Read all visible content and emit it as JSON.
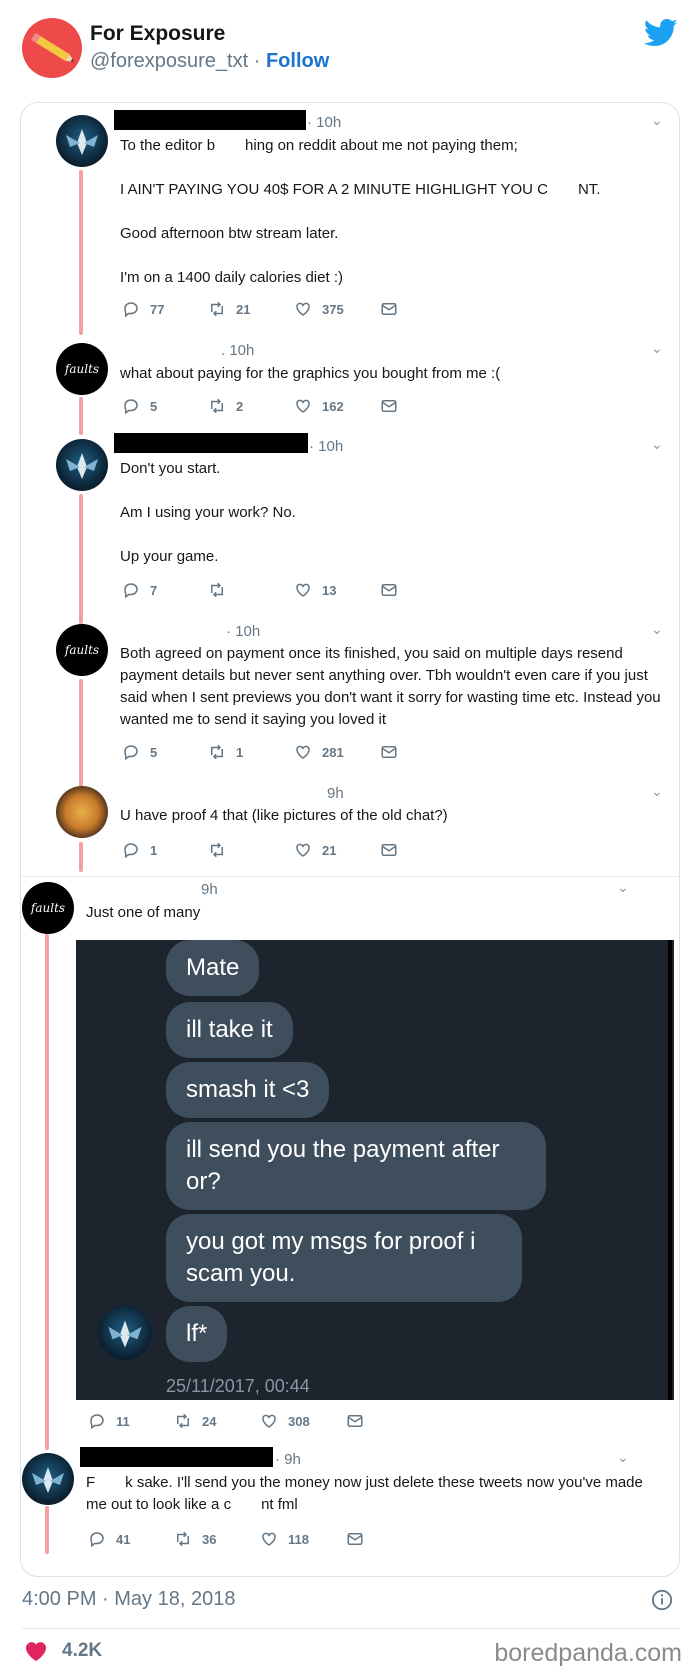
{
  "account": {
    "name": "For Exposure",
    "handle": "@forexposure_txt",
    "separator": "·",
    "follow_label": "Follow"
  },
  "tweets": [
    {
      "time": "· 10h",
      "paragraphs": [
        "To the editor b  hing on reddit about me not paying them;",
        "I AIN'T PAYING YOU 40$ FOR A 2 MINUTE HIGHLIGHT YOU C  NT.",
        "Good afternoon btw stream later.",
        "I'm on a 1400 daily calories diet :)"
      ],
      "replies": "77",
      "retweets": "21",
      "likes": "375"
    },
    {
      "time": ". 10h",
      "paragraphs": [
        "what about paying for the graphics you bought from me :("
      ],
      "replies": "5",
      "retweets": "2",
      "likes": "162"
    },
    {
      "time": "· 10h",
      "paragraphs": [
        "Don't you start.",
        "Am I using your work? No.",
        "Up your game."
      ],
      "replies": "7",
      "retweets": "",
      "likes": "13"
    },
    {
      "time": "· 10h",
      "paragraphs": [
        "Both agreed on payment once its finished, you said on multiple days resend payment details but never sent anything over. Tbh wouldn't even care if you just said when I sent previews you don't want it sorry for wasting time etc. Instead you wanted me to send it saying you loved it"
      ],
      "replies": "5",
      "retweets": "1",
      "likes": "281"
    },
    {
      "time": "9h",
      "paragraphs": [
        "U have proof 4 that (like pictures of the old chat?)"
      ],
      "replies": "1",
      "retweets": "",
      "likes": "21"
    },
    {
      "time": "9h",
      "paragraphs": [
        "Just one of many"
      ],
      "replies": "11",
      "retweets": "24",
      "likes": "308"
    },
    {
      "time": "· 9h",
      "paragraphs": [
        "F  k sake. I'll send you the money now just delete these tweets now you've made me out to look like a c  nt fml"
      ],
      "replies": "41",
      "retweets": "36",
      "likes": "118"
    }
  ],
  "chat_screenshot": {
    "messages": [
      "Mate",
      "ill take it",
      "smash it <3",
      "ill send you the payment after or?",
      "you got my msgs for proof i scam you.",
      "lf*"
    ],
    "timestamp": "25/11/2017, 00:44"
  },
  "avatar_text": "faults",
  "footer": {
    "timestamp": "4:00 PM · May 18, 2018",
    "like_count": "4.2K",
    "brand": "boredpanda.com"
  },
  "colors": {
    "twitter_blue": "#1da1f2",
    "follow_blue": "#1b75d0",
    "thread_line": "#f2a1a1",
    "heart_pink": "#e0245e",
    "avatar_red": "#ef4a4a"
  },
  "icons": [
    "pencil-icon",
    "twitter-bird-icon",
    "reply-icon",
    "retweet-icon",
    "heart-icon",
    "mail-icon",
    "chevron-down-icon",
    "info-icon"
  ]
}
